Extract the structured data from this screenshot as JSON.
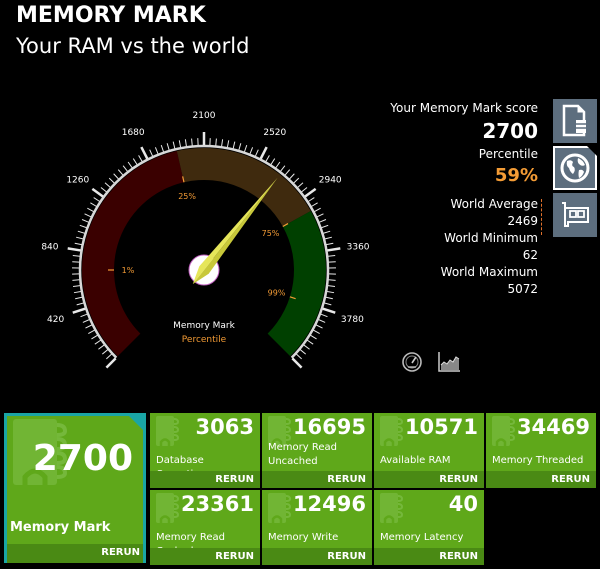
{
  "header": {
    "title": "MEMORY MARK",
    "subtitle": "Your RAM vs the world"
  },
  "gauge": {
    "min": 0,
    "max": 4200,
    "value": 2700,
    "major_ticks": [
      "0",
      "420",
      "840",
      "1260",
      "1680",
      "2100",
      "2520",
      "2940",
      "3360",
      "3780",
      "4200"
    ],
    "percentile_markers": [
      {
        "label": "1%",
        "value": 700
      },
      {
        "label": "25%",
        "value": 1900
      },
      {
        "label": "75%",
        "value": 3050
      },
      {
        "label": "99%",
        "value": 3770
      }
    ],
    "bands": [
      {
        "from": 0,
        "to": 1900,
        "color": "#3a0000"
      },
      {
        "from": 1900,
        "to": 3050,
        "color": "#3f2a0e"
      },
      {
        "from": 3050,
        "to": 4200,
        "color": "#004000"
      }
    ],
    "center_label": "Memory Mark",
    "center_sublabel": "Percentile",
    "needle_color": "#e6e65a",
    "accent_color": "#f39b35"
  },
  "score_panel": {
    "score_label": "Your Memory Mark score",
    "score": "2700",
    "percentile_label": "Percentile",
    "percentile": "59%",
    "world_average_label": "World Average",
    "world_average": "2469",
    "world_minimum_label": "World Minimum",
    "world_minimum": "62",
    "world_maximum_label": "World Maximum",
    "world_maximum": "5072"
  },
  "side_buttons": [
    {
      "name": "memory-file-icon"
    },
    {
      "name": "globe-icon",
      "active": true
    },
    {
      "name": "memory-card-icon"
    }
  ],
  "bottom_icons": [
    {
      "name": "speedometer-icon"
    },
    {
      "name": "area-chart-icon"
    }
  ],
  "tiles": {
    "main": {
      "value": "2700",
      "label": "Memory Mark",
      "rerun": "RERUN"
    },
    "items": [
      {
        "value": "3063",
        "label": "Database Operations",
        "rerun": "RERUN"
      },
      {
        "value": "16695",
        "label": "Memory Read\nUncached",
        "label_line1": "Memory Read",
        "label_line2": "Uncached",
        "rerun": "RERUN"
      },
      {
        "value": "10571",
        "label": "Available RAM",
        "rerun": "RERUN"
      },
      {
        "value": "34469",
        "label": "Memory Threaded",
        "rerun": "RERUN"
      },
      {
        "value": "23361",
        "label": "Memory Read Cached",
        "rerun": "RERUN"
      },
      {
        "value": "12496",
        "label": "Memory Write",
        "rerun": "RERUN"
      },
      {
        "value": "40",
        "label": "Memory Latency",
        "rerun": "RERUN"
      }
    ]
  }
}
